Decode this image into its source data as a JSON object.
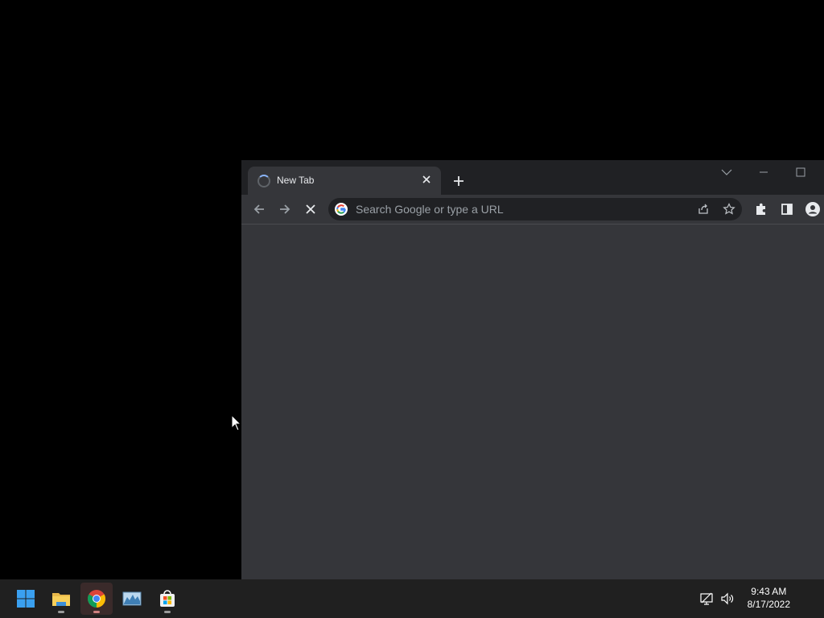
{
  "browser": {
    "tab": {
      "title": "New Tab"
    },
    "omnibox": {
      "placeholder": "Search Google or type a URL"
    }
  },
  "taskbar": {
    "apps": [
      "start",
      "file-explorer",
      "chrome",
      "resource-monitor",
      "microsoft-store"
    ],
    "clock": {
      "time": "9:43 AM",
      "date": "8/17/2022"
    }
  },
  "colors": {
    "desktop": "#000000",
    "chrome_frame": "#202124",
    "chrome_toolbar": "#35363a",
    "omnibox": "#202124",
    "taskbar": "#202020"
  }
}
